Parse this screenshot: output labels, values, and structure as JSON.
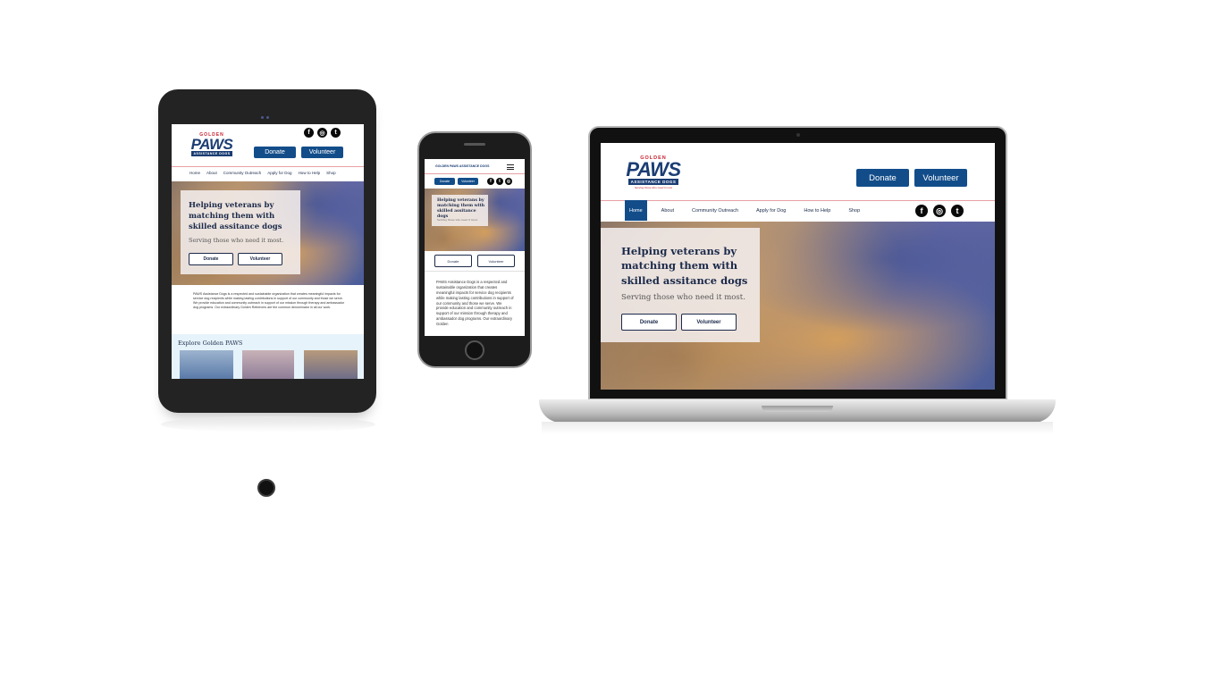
{
  "site": {
    "logo": {
      "top": "GOLDEN",
      "brand": "PAWS",
      "bar": "ASSISTANCE DOGS",
      "tagline": "Serving those who need it most"
    },
    "buttons": {
      "donate": "Donate",
      "volunteer": "Volunteer"
    },
    "nav": [
      "Home",
      "About",
      "Community Outreach",
      "Apply for Dog",
      "How to Help",
      "Shop"
    ],
    "social": {
      "facebook": "f",
      "instagram": "◎",
      "twitter": "t"
    },
    "hero": {
      "headline": "Helping veterans by matching them with skilled assitance dogs",
      "subhead": "Serving those who need it most."
    },
    "tablet_nav": [
      "Home",
      "About",
      "Community Outreach",
      "Apply for Dog",
      "How to Help",
      "Shop"
    ],
    "phone_logo": "GOLDEN PAWS ASSISTANCE DOGS",
    "intro_tablet": "PAWS Assistance Dogs is a respected and sustainable organization that creates meaningful impacts for service dog recipients while making lasting contributions in support of our community and those we serve. We provide education and community outreach in support of our mission through therapy and ambassador dog programs. Our extraordinary Golden Retrievers are the common denominator in all our work.",
    "intro_phone": "PAWS Assistance Dogs is a respected and sustainable organization that creates meaningful impacts for service dog recipients while making lasting contributions in support of our community and those we serve. We provide education and community outreach in support of our mission through therapy and ambassador dog programs. Our extraordinary Golden",
    "explore_title": "Explore Golden PAWS"
  },
  "colors": {
    "navy": "#1b2a4a",
    "button_blue": "#124d8a",
    "brand_red": "#c8202f",
    "explore_bg": "#e6f3fa"
  }
}
